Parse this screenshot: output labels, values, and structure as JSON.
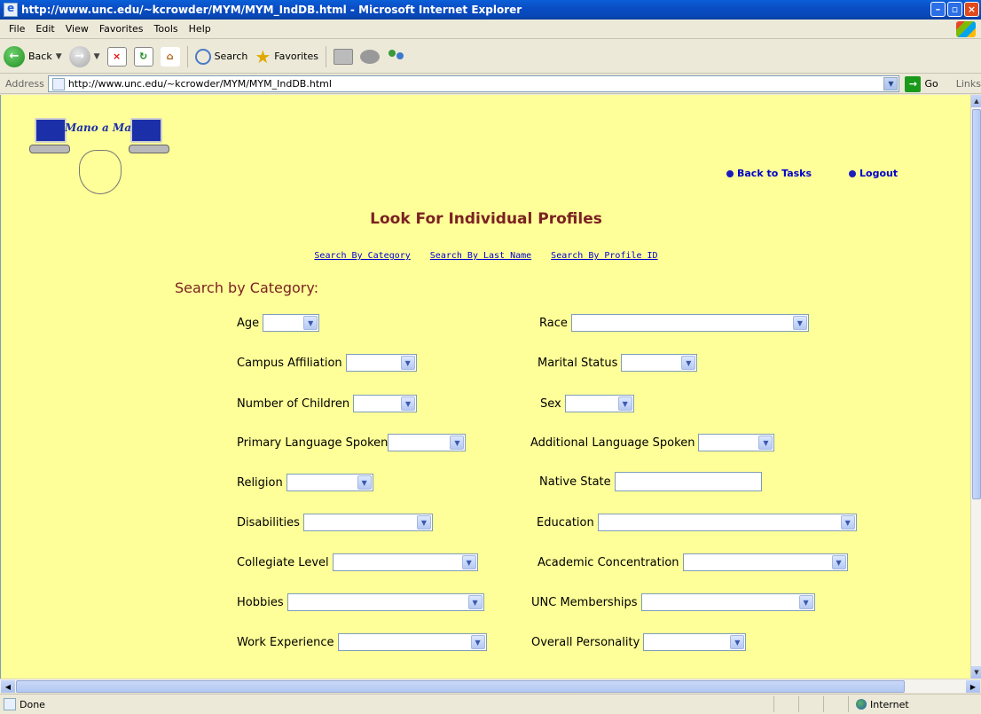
{
  "window": {
    "title": "http://www.unc.edu/~kcrowder/MYM/MYM_IndDB.html - Microsoft Internet Explorer"
  },
  "menu": [
    "File",
    "Edit",
    "View",
    "Favorites",
    "Tools",
    "Help"
  ],
  "toolbar": {
    "back": "Back",
    "search": "Search",
    "favorites": "Favorites"
  },
  "address": {
    "label": "Address",
    "url": "http://www.unc.edu/~kcrowder/MYM/MYM_IndDB.html",
    "go": "Go",
    "links": "Links"
  },
  "page": {
    "logo_text": "Mano a Mano",
    "nav": {
      "back_to_tasks": "Back to Tasks",
      "logout": "Logout"
    },
    "title": "Look For Individual Profiles",
    "sublinks": [
      "Search By Category",
      "Search By Last Name",
      "Search By Profile ID"
    ],
    "section_title": "Search by Category:",
    "fields": {
      "age": "Age",
      "race": "Race",
      "campus_affiliation": "Campus Affiliation",
      "marital_status": "Marital Status",
      "number_of_children": "Number of Children",
      "sex": "Sex",
      "primary_language": "Primary Language Spoken",
      "additional_language": "Additional Language Spoken",
      "religion": "Religion",
      "native_state": "Native State",
      "disabilities": "Disabilities",
      "education": "Education",
      "collegiate_level": "Collegiate Level",
      "academic_concentration": "Academic Concentration",
      "hobbies": "Hobbies",
      "unc_memberships": "UNC Memberships",
      "work_experience": "Work Experience",
      "overall_personality": "Overall Personality"
    }
  },
  "status": {
    "text": "Done",
    "zone": "Internet"
  },
  "colors": {
    "page_background": "#ffff99",
    "title_color": "#7a2222",
    "link_color": "#0000cc"
  }
}
